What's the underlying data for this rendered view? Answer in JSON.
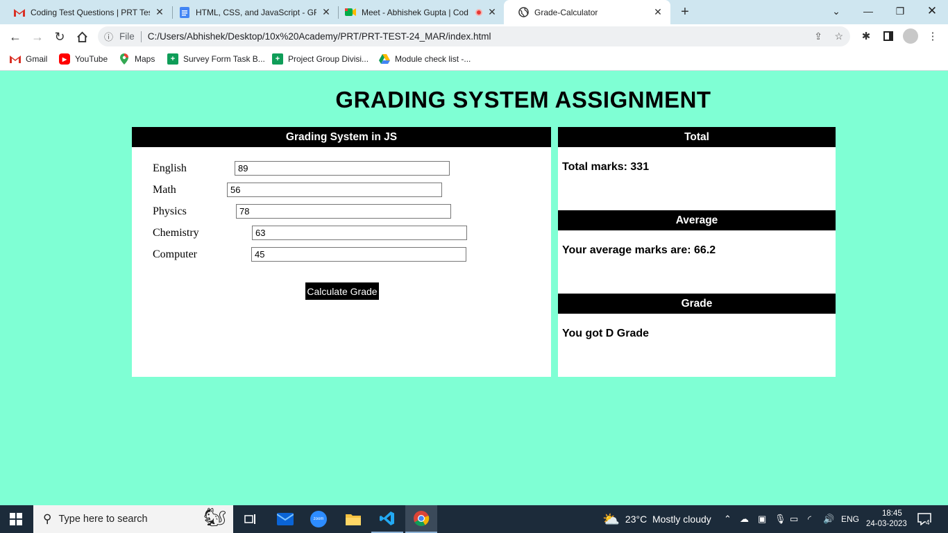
{
  "browser": {
    "tabs": [
      {
        "title": "Coding Test Questions | PRT Test",
        "icon": "gmail-icon"
      },
      {
        "title": "HTML, CSS, and JavaScript - GRA",
        "icon": "docs-icon"
      },
      {
        "title": "Meet - Abhishek Gupta | Cod",
        "icon": "meet-icon"
      },
      {
        "title": "Grade-Calculator",
        "icon": "globe-icon"
      }
    ],
    "address": {
      "scheme_label": "File",
      "url": "C:/Users/Abhishek/Desktop/10x%20Academy/PRT/PRT-TEST-24_MAR/index.html"
    },
    "bookmarks": [
      {
        "label": "Gmail"
      },
      {
        "label": "YouTube"
      },
      {
        "label": "Maps"
      },
      {
        "label": "Survey Form Task B..."
      },
      {
        "label": "Project Group Divisi..."
      },
      {
        "label": "Module check list -..."
      }
    ]
  },
  "page": {
    "title": "GRADING SYSTEM ASSIGNMENT",
    "form": {
      "heading": "Grading System in JS",
      "fields": [
        {
          "label": "English",
          "value": "89"
        },
        {
          "label": "Math",
          "value": "56"
        },
        {
          "label": "Physics",
          "value": "78"
        },
        {
          "label": "Chemistry",
          "value": "63"
        },
        {
          "label": "Computer",
          "value": "45"
        }
      ],
      "button_label": "Calculate Grade"
    },
    "total": {
      "heading": "Total",
      "text": "Total marks: 331"
    },
    "average": {
      "heading": "Average",
      "text": "Your average marks are: 66.2"
    },
    "grade": {
      "heading": "Grade",
      "text": "You got D Grade"
    }
  },
  "taskbar": {
    "search_placeholder": "Type here to search",
    "weather": "23°C  Mostly cloudy",
    "language": "ENG",
    "time": "18:45",
    "date": "24-03-2023",
    "notifications": "4"
  }
}
